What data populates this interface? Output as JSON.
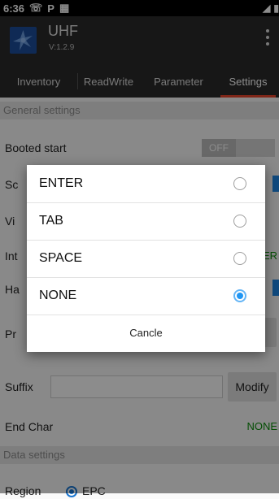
{
  "status": {
    "time": "6:36",
    "icons": [
      "wifi-calling-icon",
      "p-icon",
      "battery-saver-icon"
    ],
    "right_icons": [
      "no-sim-icon",
      "signal-icon"
    ]
  },
  "app": {
    "title": "UHF",
    "version": "V:1.2.9"
  },
  "tabs": [
    {
      "label": "Inventory"
    },
    {
      "label": "ReadWrite"
    },
    {
      "label": "Parameter"
    },
    {
      "label": "Settings",
      "active": true
    }
  ],
  "settings": {
    "general_header": "General settings",
    "booted_start": {
      "label": "Booted start",
      "toggle": "OFF"
    },
    "partial_labels": {
      "sc": "Sc",
      "vi": "Vi",
      "int": "Int",
      "ha": "Ha",
      "pr": "Pr",
      "int_value": "ER",
      "pr_button": "y"
    },
    "suffix": {
      "label": "Suffix",
      "value": "",
      "button": "Modify"
    },
    "end_char": {
      "label": "End Char",
      "value": "NONE"
    },
    "data_header": "Data settings",
    "region": {
      "label": "Region",
      "option": "EPC"
    }
  },
  "dialog": {
    "options": [
      {
        "label": "ENTER",
        "selected": false
      },
      {
        "label": "TAB",
        "selected": false
      },
      {
        "label": "SPACE",
        "selected": false
      },
      {
        "label": "NONE",
        "selected": true
      }
    ],
    "cancel": "Cancle"
  },
  "colors": {
    "accent": "#e8452c",
    "radio": "#2196f3",
    "green": "#0a8f0a"
  }
}
